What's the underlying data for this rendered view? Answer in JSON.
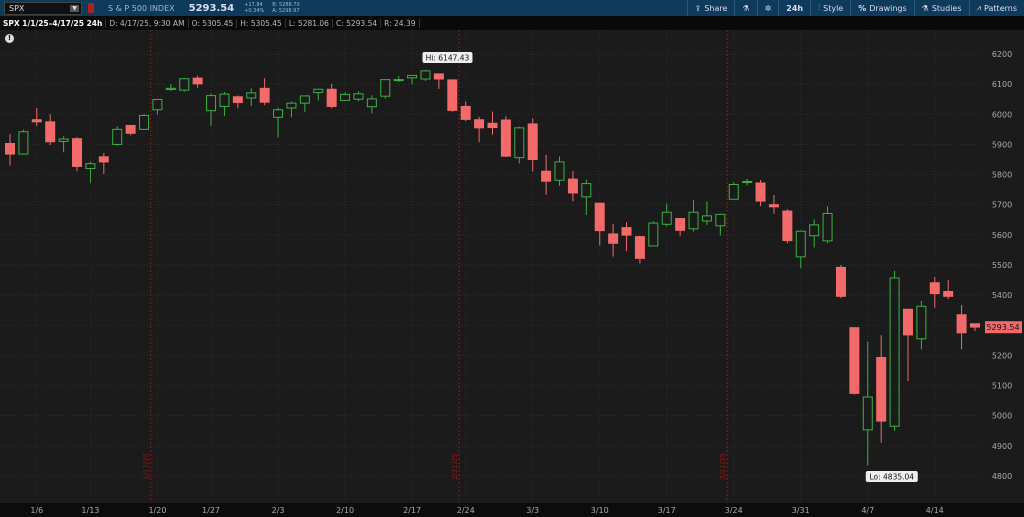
{
  "header": {
    "symbol": "SPX",
    "name": "S & P 500 INDEX",
    "last": "5293.54",
    "change": "+17.84",
    "change_pct": "+0.34%",
    "bid": "B: 5288.70",
    "ask": "A: 5298.97"
  },
  "toolbar": {
    "share": "Share",
    "interval": "24h",
    "style": "Style",
    "drawings": "Drawings",
    "studies": "Studies",
    "patterns": "Patterns"
  },
  "info": {
    "title": "SPX 1/1/25–4/17/25 24h",
    "date": "D: 4/17/25, 9:30 AM",
    "open": "O: 5305.45",
    "high": "H: 5305.45",
    "low": "L: 5281.06",
    "close": "C: 5293.54",
    "range": "R: 24.39"
  },
  "annotations": {
    "hi": "Hi: 6147.43",
    "lo": "Lo: 4835.04",
    "price_label": "5293.54"
  },
  "colors": {
    "up": "#3cb043",
    "down": "#f26a6a",
    "bg": "#1b1b1b",
    "grid": "#2c2c2c",
    "expiry": "#8b1a1a"
  },
  "chart_data": {
    "type": "candlestick",
    "ylim": [
      4750,
      6250
    ],
    "yticks": [
      4800,
      4900,
      5000,
      5100,
      5200,
      5300,
      5400,
      5500,
      5600,
      5700,
      5800,
      5900,
      6000,
      6100,
      6200
    ],
    "xticks": [
      {
        "label": "1/6",
        "index": 2
      },
      {
        "label": "1/13",
        "index": 6
      },
      {
        "label": "1/20",
        "index": 11
      },
      {
        "label": "1/27",
        "index": 15
      },
      {
        "label": "2/3",
        "index": 20
      },
      {
        "label": "2/10",
        "index": 25
      },
      {
        "label": "2/17",
        "index": 30
      },
      {
        "label": "2/24",
        "index": 34
      },
      {
        "label": "3/3",
        "index": 39
      },
      {
        "label": "3/10",
        "index": 44
      },
      {
        "label": "3/17",
        "index": 49
      },
      {
        "label": "3/24",
        "index": 54
      },
      {
        "label": "3/31",
        "index": 59
      },
      {
        "label": "4/7",
        "index": 64
      },
      {
        "label": "4/14",
        "index": 69
      }
    ],
    "expirations": [
      {
        "label": "1/17/25",
        "index": 10.5
      },
      {
        "label": "2/21/25",
        "index": 33.5
      },
      {
        "label": "3/21/25",
        "index": 53.5
      }
    ],
    "candles": [
      [
        "1/2",
        5903,
        5935,
        5830,
        5868
      ],
      [
        "1/3",
        5868,
        5949,
        5866,
        5942
      ],
      [
        "1/6",
        5982,
        6021,
        5961,
        5975
      ],
      [
        "1/7",
        5975,
        6000,
        5898,
        5909
      ],
      [
        "1/8",
        5910,
        5927,
        5874,
        5918
      ],
      [
        "1/10",
        5919,
        5925,
        5811,
        5827
      ],
      [
        "1/13",
        5820,
        5843,
        5773,
        5836
      ],
      [
        "1/14",
        5859,
        5871,
        5802,
        5842
      ],
      [
        "1/15",
        5900,
        5960,
        5895,
        5950
      ],
      [
        "1/16",
        5963,
        5964,
        5930,
        5937
      ],
      [
        "1/17",
        5950,
        6000,
        5948,
        5996
      ],
      [
        "1/21",
        6015,
        6051,
        6000,
        6049
      ],
      [
        "1/22",
        6082,
        6100,
        6078,
        6086
      ],
      [
        "1/23",
        6080,
        6119,
        6075,
        6118
      ],
      [
        "1/24",
        6120,
        6128,
        6088,
        6101
      ],
      [
        "1/27",
        6012,
        6069,
        5962,
        6062
      ],
      [
        "1/28",
        6026,
        6074,
        5994,
        6067
      ],
      [
        "1/29",
        6058,
        6062,
        6020,
        6039
      ],
      [
        "1/30",
        6054,
        6086,
        6028,
        6071
      ],
      [
        "1/31",
        6086,
        6120,
        6030,
        6040
      ],
      [
        "2/3",
        5990,
        6022,
        5923,
        6015
      ],
      [
        "2/4",
        6021,
        6042,
        5990,
        6037
      ],
      [
        "2/5",
        6037,
        6062,
        6008,
        6061
      ],
      [
        "2/6",
        6072,
        6084,
        6046,
        6083
      ],
      [
        "2/7",
        6083,
        6101,
        6020,
        6026
      ],
      [
        "2/10",
        6046,
        6073,
        6044,
        6066
      ],
      [
        "2/11",
        6050,
        6076,
        6043,
        6068
      ],
      [
        "2/12",
        6025,
        6063,
        6003,
        6051
      ],
      [
        "2/13",
        6060,
        6116,
        6052,
        6115
      ],
      [
        "2/14",
        6115,
        6127,
        6107,
        6115
      ],
      [
        "2/18",
        6121,
        6129,
        6099,
        6129
      ],
      [
        "2/19",
        6117,
        6147.43,
        6111,
        6144
      ],
      [
        "2/20",
        6134,
        6134,
        6084,
        6117
      ],
      [
        "2/21",
        6114,
        6114,
        6008,
        6013
      ],
      [
        "2/24",
        6026,
        6043,
        5977,
        5983
      ],
      [
        "2/25",
        5982,
        5992,
        5908,
        5955
      ],
      [
        "2/26",
        5970,
        6009,
        5932,
        5956
      ],
      [
        "2/27",
        5981,
        5994,
        5858,
        5861
      ],
      [
        "2/28",
        5856,
        5959,
        5837,
        5955
      ],
      [
        "3/3",
        5968,
        5986,
        5810,
        5850
      ],
      [
        "3/4",
        5811,
        5865,
        5733,
        5778
      ],
      [
        "3/5",
        5781,
        5860,
        5762,
        5842
      ],
      [
        "3/6",
        5785,
        5812,
        5711,
        5739
      ],
      [
        "3/7",
        5726,
        5783,
        5666,
        5770
      ],
      [
        "3/10",
        5705,
        5705,
        5565,
        5614
      ],
      [
        "3/11",
        5603,
        5636,
        5528,
        5572
      ],
      [
        "3/12",
        5624,
        5642,
        5546,
        5599
      ],
      [
        "3/13",
        5594,
        5597,
        5505,
        5522
      ],
      [
        "3/14",
        5563,
        5645,
        5563,
        5639
      ],
      [
        "3/17",
        5635,
        5704,
        5628,
        5675
      ],
      [
        "3/18",
        5654,
        5654,
        5597,
        5615
      ],
      [
        "3/19",
        5620,
        5715,
        5611,
        5675
      ],
      [
        "3/20",
        5646,
        5711,
        5633,
        5663
      ],
      [
        "3/21",
        5630,
        5670,
        5598,
        5668
      ],
      [
        "3/24",
        5718,
        5775,
        5718,
        5767
      ],
      [
        "3/25",
        5775,
        5786,
        5764,
        5777
      ],
      [
        "3/26",
        5772,
        5782,
        5695,
        5712
      ],
      [
        "3/27",
        5700,
        5732,
        5670,
        5693
      ],
      [
        "3/28",
        5679,
        5685,
        5572,
        5581
      ],
      [
        "3/31",
        5527,
        5615,
        5489,
        5612
      ],
      [
        "4/1",
        5597,
        5651,
        5558,
        5633
      ],
      [
        "4/2",
        5580,
        5695,
        5572,
        5671
      ],
      [
        "4/3",
        5492,
        5500,
        5390,
        5396
      ],
      [
        "4/4",
        5292,
        5292,
        5070,
        5074
      ],
      [
        "4/7",
        4953,
        5246,
        4835.04,
        5062
      ],
      [
        "4/8",
        5193,
        5267,
        4910,
        4982
      ],
      [
        "4/9",
        4965,
        5481,
        4950,
        5457
      ],
      [
        "4/10",
        5353,
        5353,
        5115,
        5268
      ],
      [
        "4/11",
        5255,
        5381,
        5220,
        5363
      ],
      [
        "4/14",
        5441,
        5460,
        5358,
        5405
      ],
      [
        "4/15",
        5412,
        5450,
        5387,
        5396
      ],
      [
        "4/16",
        5335,
        5367,
        5220,
        5275
      ],
      [
        "4/17",
        5305,
        5305.45,
        5281.06,
        5294
      ]
    ]
  }
}
